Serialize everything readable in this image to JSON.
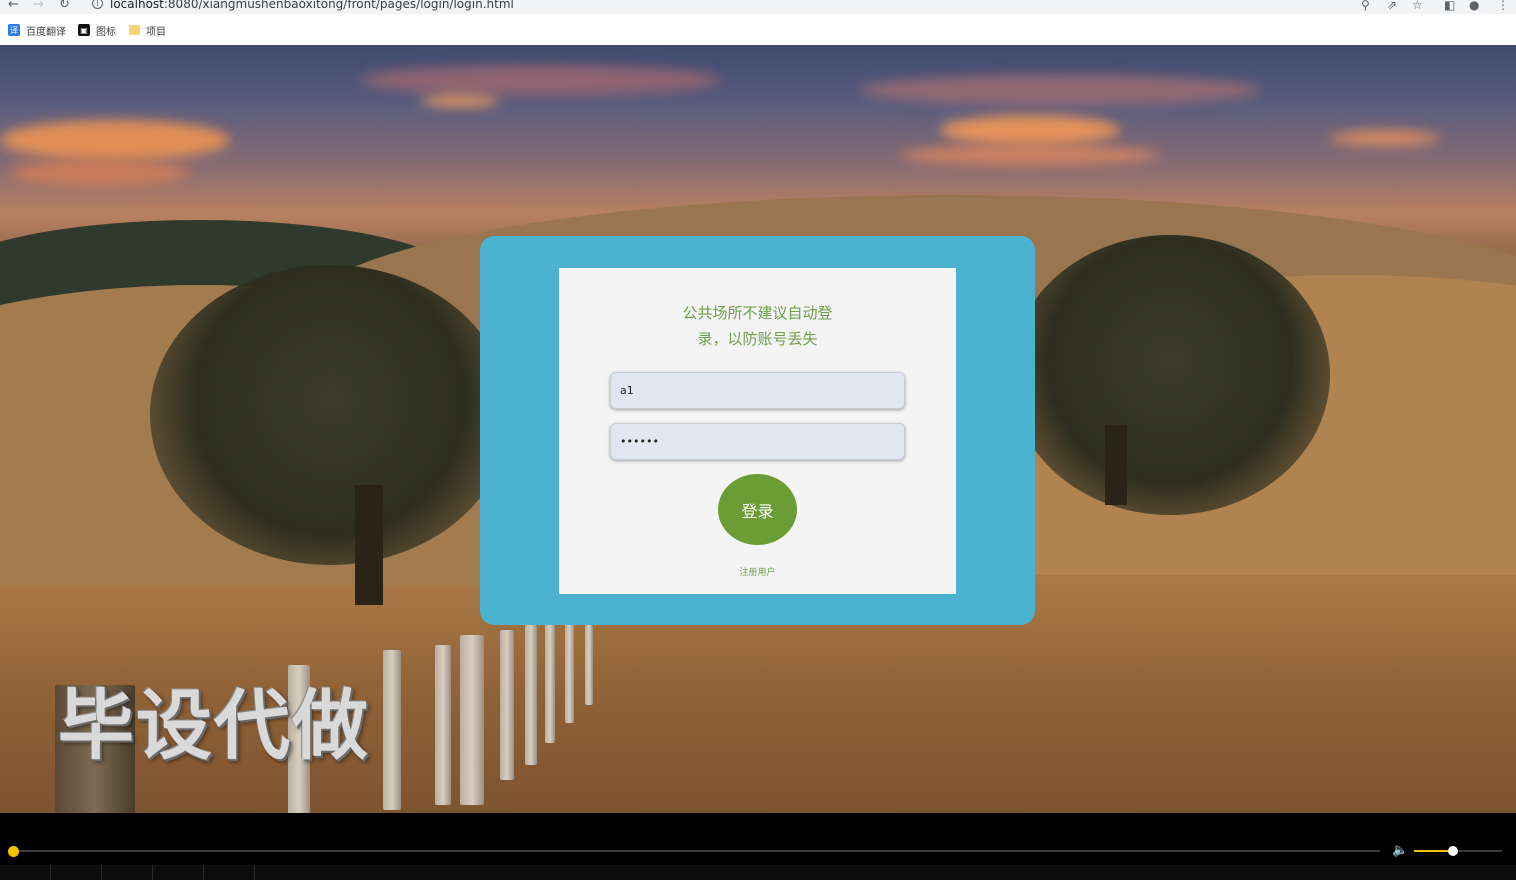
{
  "browser": {
    "url_host": "localhost",
    "url_rest": ":8080/xiangmushenbaoxitong/front/pages/login/login.html",
    "bookmarks": [
      {
        "label": "百度翻译",
        "icon": "translate-icon"
      },
      {
        "label": "图标",
        "icon": "image-icon"
      },
      {
        "label": "项目",
        "icon": "folder-icon"
      }
    ]
  },
  "login": {
    "notice_line1": "公共场所不建议自动登",
    "notice_line2": "录，以防账号丢失",
    "username_value": "a1",
    "password_value": "123456",
    "login_label": "登录",
    "register_label": "注册用户"
  },
  "watermark": "毕设代做",
  "player": {
    "progress": 0.0,
    "volume": 0.4
  },
  "colors": {
    "card": "#4bb2cf",
    "accent_green": "#6a9d36",
    "text_green": "#6f9f4a",
    "player_accent": "#f5c400"
  }
}
